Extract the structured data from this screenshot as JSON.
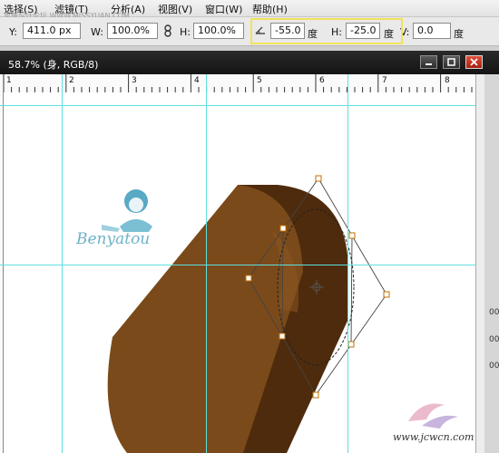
{
  "menu": {
    "items": [
      "选择(S)",
      "滤镜(T)",
      "分析(A)",
      "视图(V)",
      "窗口(W)",
      "帮助(H)"
    ],
    "watermark": "思缘设计论坛  WWW.MISSYUAN.COM"
  },
  "options": {
    "y_label": "Y:",
    "y_value": "411.0 px",
    "w_label": "W:",
    "w_value": "100.0%",
    "link_icon": "chain-link-icon",
    "h_label": "H:",
    "h_value": "100.0%",
    "angle_icon": "rotate-angle-icon",
    "angle_value": "-55.0",
    "angle_unit": "度",
    "hskew_label": "H:",
    "hskew_value": "-25.0",
    "hskew_unit": "度",
    "vskew_label": "V:",
    "vskew_value": "0.0",
    "vskew_unit": "度"
  },
  "document": {
    "title": "58.7% (身, RGB/8)",
    "buttons": [
      "minimize",
      "restore",
      "close"
    ]
  },
  "ruler": {
    "marks": [
      "1",
      "2",
      "3",
      "4",
      "5",
      "6",
      "7",
      "8"
    ]
  },
  "right_panel": {
    "labels": [
      "00",
      "00",
      "00"
    ]
  },
  "canvas": {
    "logo_text": "Benyatou",
    "shape_colors": {
      "side": "#4e2b0c",
      "face": "#7b4a1a",
      "highlight": "#8d5622"
    },
    "transform_box_color": "#444444",
    "handle_color": "#c07000"
  },
  "watermark": {
    "site": "www.jcwcn.com"
  }
}
